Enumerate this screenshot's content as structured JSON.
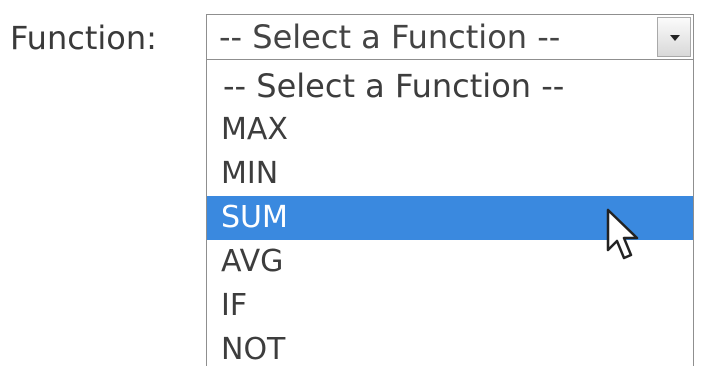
{
  "field": {
    "label": "Function:"
  },
  "select": {
    "value": "-- Select a Function --",
    "options": [
      {
        "label": "-- Select a Function --",
        "selected": false
      },
      {
        "label": "MAX",
        "selected": false
      },
      {
        "label": "MIN",
        "selected": false
      },
      {
        "label": "SUM",
        "selected": true
      },
      {
        "label": "AVG",
        "selected": false
      },
      {
        "label": "IF",
        "selected": false
      },
      {
        "label": "NOT",
        "selected": false
      }
    ]
  },
  "colors": {
    "highlight": "#3a89df",
    "text": "#3d3d3d"
  },
  "icons": {
    "dropdown": "chevron-down-icon",
    "cursor": "mouse-pointer-icon"
  }
}
